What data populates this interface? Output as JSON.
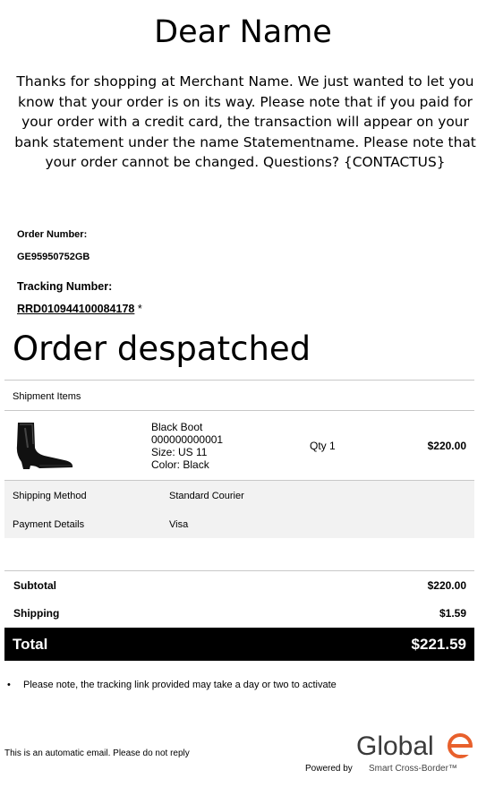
{
  "greeting": "Dear Name",
  "intro": "Thanks for shopping at Merchant Name. We just wanted to let you know that your order is on its way. Please note that if you paid for your order with a credit card, the transaction will appear on your bank statement under the name Statementname. Please note that your order cannot be changed. Questions? {CONTACTUS}",
  "order": {
    "number_label": "Order Number:",
    "number": "GE95950752GB",
    "tracking_label": "Tracking Number:",
    "tracking_number": "RRD010944100084178",
    "tracking_suffix": " *"
  },
  "status_title": "Order despatched",
  "shipment": {
    "header": "Shipment Items",
    "item": {
      "image": "black-chelsea-boot",
      "name": "Black Boot",
      "sku": "000000000001",
      "size": "Size: US 11",
      "color": "Color: Black",
      "qty": "Qty 1",
      "price": "$220.00"
    },
    "shipping_method_label": "Shipping Method",
    "shipping_method": "Standard Courier",
    "payment_label": "Payment Details",
    "payment": "Visa"
  },
  "summary": {
    "subtotal_label": "Subtotal",
    "subtotal": "$220.00",
    "shipping_label": "Shipping",
    "shipping": "$1.59",
    "total_label": "Total",
    "total": "$221.59"
  },
  "note": "Please note, the tracking link provided may take a day or two to activate",
  "footer": {
    "automatic": "This is an automatic email. Please do not reply",
    "powered_by": "Powered by",
    "brand": "Global e",
    "tagline": "Smart Cross-Border™"
  },
  "colors": {
    "brand_accent": "#e8602c",
    "brand_dark": "#3a3a3a",
    "total_bar": "#000000",
    "detail_bg": "#f2f2f2"
  }
}
